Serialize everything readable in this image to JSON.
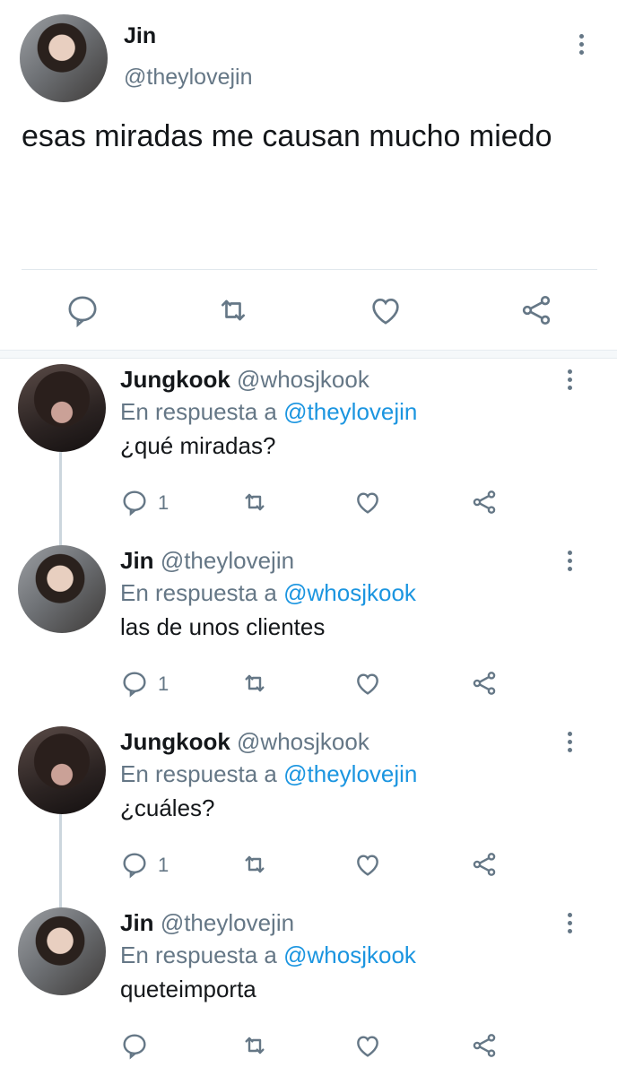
{
  "main_tweet": {
    "name": "Jin",
    "handle": "@theylovejin",
    "text": "esas miradas me causan mucho miedo"
  },
  "replies": [
    {
      "name": "Jungkook",
      "handle": "@whosjkook",
      "reply_prefix": "En respuesta a",
      "reply_to": "@theylovejin",
      "text": "¿qué miradas?",
      "reply_count": "1"
    },
    {
      "name": "Jin",
      "handle": "@theylovejin",
      "reply_prefix": "En respuesta a",
      "reply_to": "@whosjkook",
      "text": "las de unos clientes",
      "reply_count": "1"
    },
    {
      "name": "Jungkook",
      "handle": "@whosjkook",
      "reply_prefix": "En respuesta a",
      "reply_to": "@theylovejin",
      "text": "¿cuáles?",
      "reply_count": "1"
    },
    {
      "name": "Jin",
      "handle": "@theylovejin",
      "reply_prefix": "En respuesta a",
      "reply_to": "@whosjkook",
      "text": "queteimporta",
      "reply_count": ""
    }
  ],
  "colors": {
    "text": "#14171a",
    "muted": "#657786",
    "link": "#1b95e0",
    "icon": "#657786"
  },
  "icons": [
    "reply-icon",
    "retweet-icon",
    "like-icon",
    "share-icon",
    "more-icon"
  ]
}
